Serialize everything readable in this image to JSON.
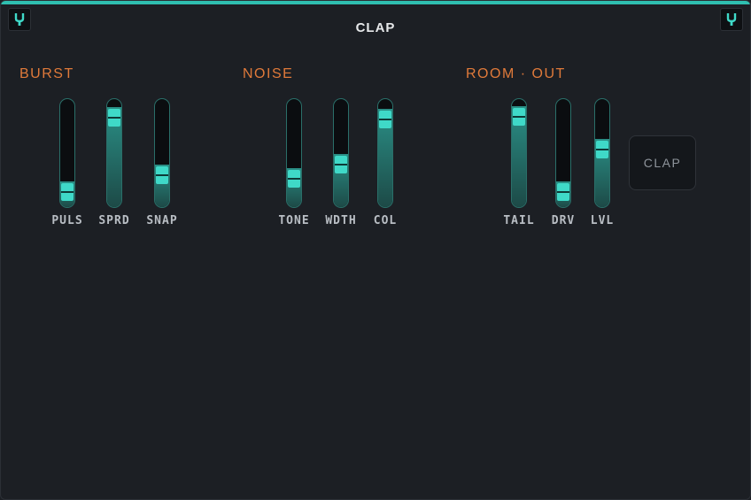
{
  "header": {
    "title": "CLAP"
  },
  "sections": [
    {
      "label": "BURST"
    },
    {
      "label": "NOISE"
    },
    {
      "label": "ROOM · OUT"
    }
  ],
  "faders": [
    {
      "label": "PULS",
      "value": 0.05
    },
    {
      "label": "SPRD",
      "value": 0.93
    },
    {
      "label": "SNAP",
      "value": 0.25
    },
    {
      "label": "TONE",
      "value": 0.21
    },
    {
      "label": "WDTH",
      "value": 0.38
    },
    {
      "label": "COL",
      "value": 0.91
    },
    {
      "label": "TAIL",
      "value": 0.94
    },
    {
      "label": "DRV",
      "value": 0.05
    },
    {
      "label": "LVL",
      "value": 0.55
    }
  ],
  "trigger_button": {
    "label": "CLAP"
  },
  "colors": {
    "accent": "#3fd9c8",
    "section_label": "#e07a3a",
    "background": "#1c1f24"
  },
  "icons": {
    "corner_left": "tuning-fork-icon",
    "corner_right": "tuning-fork-icon"
  }
}
